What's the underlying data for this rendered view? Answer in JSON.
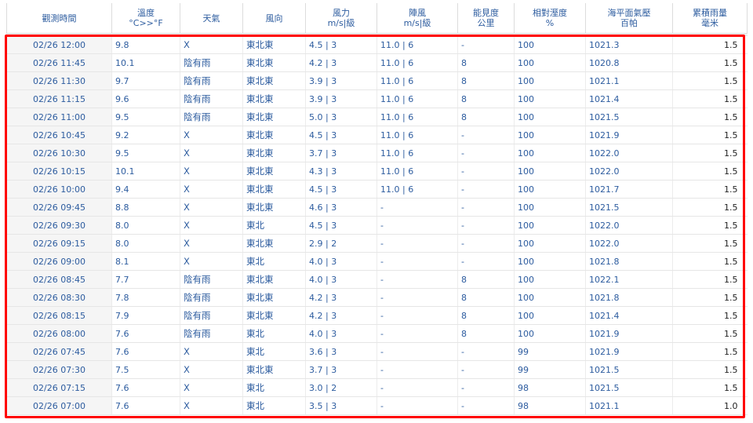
{
  "headers": [
    [
      "觀測時間"
    ],
    [
      "溫度",
      "°C>>°F"
    ],
    [
      "天氣"
    ],
    [
      "風向"
    ],
    [
      "風力",
      "m/s|級"
    ],
    [
      "陣風",
      "m/s|級"
    ],
    [
      "能見度",
      "公里"
    ],
    [
      "相對溼度",
      "%"
    ],
    [
      "海平面氣壓",
      "百帕"
    ],
    [
      "累積雨量",
      "毫米"
    ]
  ],
  "rows": [
    [
      "02/26 12:00",
      "9.8",
      "X",
      "東北東",
      "4.5 | 3",
      "11.0 | 6",
      "-",
      "100",
      "1021.3",
      "1.5"
    ],
    [
      "02/26 11:45",
      "10.1",
      "陰有雨",
      "東北東",
      "4.2 | 3",
      "11.0 | 6",
      "8",
      "100",
      "1020.8",
      "1.5"
    ],
    [
      "02/26 11:30",
      "9.7",
      "陰有雨",
      "東北東",
      "3.9 | 3",
      "11.0 | 6",
      "8",
      "100",
      "1021.1",
      "1.5"
    ],
    [
      "02/26 11:15",
      "9.6",
      "陰有雨",
      "東北東",
      "3.9 | 3",
      "11.0 | 6",
      "8",
      "100",
      "1021.4",
      "1.5"
    ],
    [
      "02/26 11:00",
      "9.5",
      "陰有雨",
      "東北東",
      "5.0 | 3",
      "11.0 | 6",
      "8",
      "100",
      "1021.5",
      "1.5"
    ],
    [
      "02/26 10:45",
      "9.2",
      "X",
      "東北東",
      "4.5 | 3",
      "11.0 | 6",
      "-",
      "100",
      "1021.9",
      "1.5"
    ],
    [
      "02/26 10:30",
      "9.5",
      "X",
      "東北東",
      "3.7 | 3",
      "11.0 | 6",
      "-",
      "100",
      "1022.0",
      "1.5"
    ],
    [
      "02/26 10:15",
      "10.1",
      "X",
      "東北東",
      "4.3 | 3",
      "11.0 | 6",
      "-",
      "100",
      "1022.0",
      "1.5"
    ],
    [
      "02/26 10:00",
      "9.4",
      "X",
      "東北東",
      "4.5 | 3",
      "11.0 | 6",
      "-",
      "100",
      "1021.7",
      "1.5"
    ],
    [
      "02/26 09:45",
      "8.8",
      "X",
      "東北東",
      "4.6 | 3",
      "-",
      "-",
      "100",
      "1021.5",
      "1.5"
    ],
    [
      "02/26 09:30",
      "8.0",
      "X",
      "東北",
      "4.5 | 3",
      "-",
      "-",
      "100",
      "1022.0",
      "1.5"
    ],
    [
      "02/26 09:15",
      "8.0",
      "X",
      "東北東",
      "2.9 | 2",
      "-",
      "-",
      "100",
      "1022.0",
      "1.5"
    ],
    [
      "02/26 09:00",
      "8.1",
      "X",
      "東北",
      "4.0 | 3",
      "-",
      "-",
      "100",
      "1021.8",
      "1.5"
    ],
    [
      "02/26 08:45",
      "7.7",
      "陰有雨",
      "東北東",
      "4.0 | 3",
      "-",
      "8",
      "100",
      "1022.1",
      "1.5"
    ],
    [
      "02/26 08:30",
      "7.8",
      "陰有雨",
      "東北東",
      "4.2 | 3",
      "-",
      "8",
      "100",
      "1021.8",
      "1.5"
    ],
    [
      "02/26 08:15",
      "7.9",
      "陰有雨",
      "東北東",
      "4.2 | 3",
      "-",
      "8",
      "100",
      "1021.4",
      "1.5"
    ],
    [
      "02/26 08:00",
      "7.6",
      "陰有雨",
      "東北",
      "4.0 | 3",
      "-",
      "8",
      "100",
      "1021.9",
      "1.5"
    ],
    [
      "02/26 07:45",
      "7.6",
      "X",
      "東北",
      "3.6 | 3",
      "-",
      "-",
      "99",
      "1021.9",
      "1.5"
    ],
    [
      "02/26 07:30",
      "7.5",
      "X",
      "東北東",
      "3.7 | 3",
      "-",
      "-",
      "99",
      "1021.5",
      "1.5"
    ],
    [
      "02/26 07:15",
      "7.6",
      "X",
      "東北",
      "3.0 | 2",
      "-",
      "-",
      "98",
      "1021.5",
      "1.5"
    ],
    [
      "02/26 07:00",
      "7.6",
      "X",
      "東北",
      "3.5 | 3",
      "-",
      "-",
      "98",
      "1021.1",
      "1.0"
    ]
  ],
  "colors": {
    "text": "#2d5c9f",
    "highlight": "#ff0000",
    "time_bg": "#f5f5f5"
  }
}
